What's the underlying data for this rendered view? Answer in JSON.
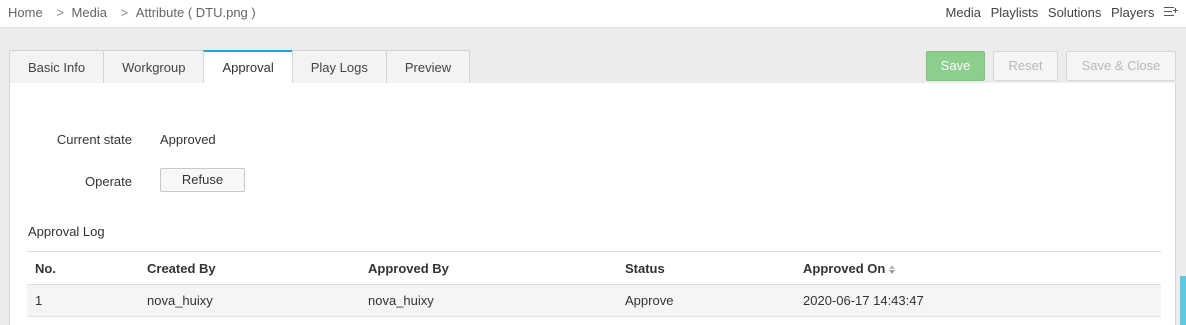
{
  "breadcrumb": {
    "home": "Home",
    "media": "Media",
    "current": "Attribute ( DTU.png )",
    "separator": ">"
  },
  "top_nav": {
    "items": [
      "Media",
      "Playlists",
      "Solutions",
      "Players"
    ],
    "menu_icon": "menu-plus-icon"
  },
  "tabs": [
    "Basic Info",
    "Workgroup",
    "Approval",
    "Play Logs",
    "Preview"
  ],
  "active_tab": "Approval",
  "toolbar": {
    "save_label": "Save",
    "reset_label": "Reset",
    "save_close_label": "Save & Close"
  },
  "approval": {
    "current_state_label": "Current state",
    "current_state_value": "Approved",
    "operate_label": "Operate",
    "refuse_label": "Refuse"
  },
  "log": {
    "title": "Approval Log",
    "columns": [
      "No.",
      "Created By",
      "Approved By",
      "Status",
      "Approved On"
    ],
    "rows": [
      {
        "no": "1",
        "created_by": "nova_huixy",
        "approved_by": "nova_huixy",
        "status": "Approve",
        "approved_on": "2020-06-17 14:43:47"
      }
    ]
  },
  "colors": {
    "accent": "#1ea2dc",
    "save_button": "#8ccf8c"
  }
}
